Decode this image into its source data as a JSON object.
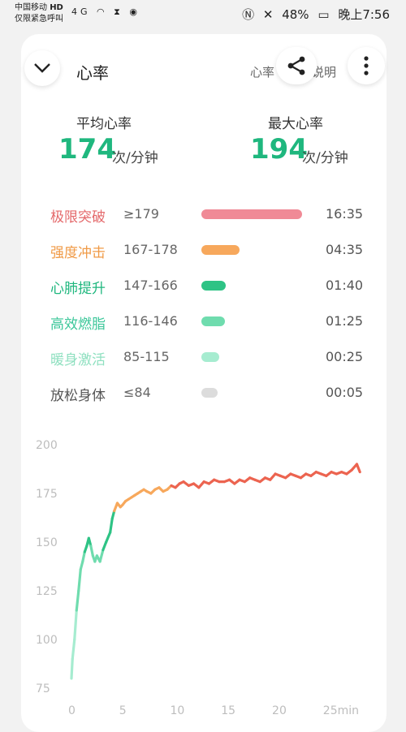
{
  "status_bar": {
    "carrier_line1": "中国移动",
    "carrier_badge": "HD",
    "carrier_line2": "仅限紧急呼叫",
    "signal": "4G",
    "battery": "48%",
    "time": "晚上7:56"
  },
  "header": {
    "title": "心率",
    "explain_fragment": "心率",
    "explain_fragment2": "说明"
  },
  "stats": {
    "avg_label": "平均心率",
    "avg_value": "174",
    "avg_unit": "次/分钟",
    "max_label": "最大心率",
    "max_value": "194",
    "max_unit": "次/分钟"
  },
  "zones": [
    {
      "name": "极限突破",
      "range": "≥179",
      "time": "16:35",
      "color": "#f08a96",
      "fraction": 1.0
    },
    {
      "name": "强度冲击",
      "range": "167-178",
      "time": "04:35",
      "color": "#f7a85c",
      "fraction": 0.38
    },
    {
      "name": "心肺提升",
      "range": "147-166",
      "time": "01:40",
      "color": "#2ec385",
      "fraction": 0.24
    },
    {
      "name": "高效燃脂",
      "range": "116-146",
      "time": "01:25",
      "color": "#6fdcae",
      "fraction": 0.23
    },
    {
      "name": "暖身激活",
      "range": "85-115",
      "time": "00:25",
      "color": "#a6ecd0",
      "fraction": 0.18
    },
    {
      "name": "放松身体",
      "range": "≤84",
      "time": "00:05",
      "color": "#dcdcdc",
      "fraction": 0.16
    }
  ],
  "zone_name_colors": [
    "#e4686a",
    "#f09a46",
    "#1fb77e",
    "#3cc79a",
    "#8fe0c0",
    "#555555"
  ],
  "chart_data": {
    "type": "line",
    "y_ticks": [
      "200",
      "175",
      "150",
      "125",
      "100",
      "75"
    ],
    "x_ticks": [
      "0",
      "5",
      "10",
      "15",
      "20",
      "25min"
    ],
    "ylim": [
      75,
      200
    ],
    "xlim": [
      0,
      29
    ],
    "x": [
      0,
      0.1,
      0.3,
      0.5,
      0.7,
      0.9,
      1.1,
      1.3,
      1.5,
      1.7,
      1.9,
      2.1,
      2.3,
      2.5,
      2.8,
      3.1,
      3.4,
      3.8,
      4.0,
      4.2,
      4.5,
      4.8,
      5.0,
      5.3,
      5.6,
      5.9,
      6.2,
      6.5,
      6.8,
      7.1,
      7.4,
      7.8,
      8.2,
      8.6,
      9.0,
      9.4,
      9.8,
      10.2,
      10.6,
      11.0,
      11.5,
      12.0,
      12.5,
      13.0,
      13.5,
      14.0,
      14.5,
      15.0,
      15.5,
      16.0,
      16.5,
      17.0,
      17.5,
      18.0,
      18.5,
      19.0,
      19.5,
      20.0,
      20.5,
      21.0,
      21.5,
      22.0,
      22.5,
      23.0,
      23.5,
      24.0,
      24.5,
      25.0,
      25.5,
      26.0,
      26.5,
      27.0,
      27.5,
      28.0,
      28.3
    ],
    "values": [
      80,
      90,
      100,
      115,
      125,
      136,
      140,
      145,
      148,
      152,
      148,
      143,
      140,
      143,
      140,
      146,
      150,
      155,
      162,
      166,
      170,
      168,
      169,
      171,
      172,
      173,
      174,
      175,
      176,
      177,
      176,
      175,
      177,
      178,
      176,
      177,
      179,
      178,
      180,
      181,
      179,
      180,
      178,
      181,
      180,
      182,
      181,
      181,
      182,
      180,
      182,
      181,
      183,
      182,
      181,
      183,
      182,
      185,
      184,
      183,
      185,
      184,
      183,
      185,
      184,
      186,
      185,
      184,
      186,
      185,
      186,
      185,
      187,
      190,
      186
    ],
    "zone_colors": {
      "warm": "#a6ecd0",
      "fatburn": "#6fdcae",
      "cardio": "#2ec385",
      "intense": "#f7a85c",
      "extreme": "#ec6450",
      "relax": "#dcdcdc"
    }
  }
}
